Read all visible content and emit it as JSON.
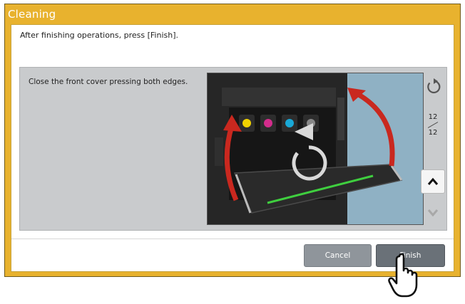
{
  "dialog": {
    "title": "Cleaning",
    "message": "After finishing operations, press [Finish].",
    "instruction": "Close the front cover pressing both edges."
  },
  "pager": {
    "current": "12",
    "total": "12"
  },
  "buttons": {
    "cancel": "Cancel",
    "finish": "Finish"
  },
  "icons": {
    "replay": "rotate-ccw-icon",
    "up": "chevron-up-icon",
    "down": "chevron-down-icon",
    "pointer": "hand-pointer-icon"
  },
  "colors": {
    "frame": "#e8b22e",
    "arrow": "#c9281f",
    "toner_yellow": "#f1d200",
    "toner_magenta": "#d32c8c",
    "toner_cyan": "#19a8d6",
    "button_dark": "#6a7178",
    "button_light": "#8f959b"
  }
}
